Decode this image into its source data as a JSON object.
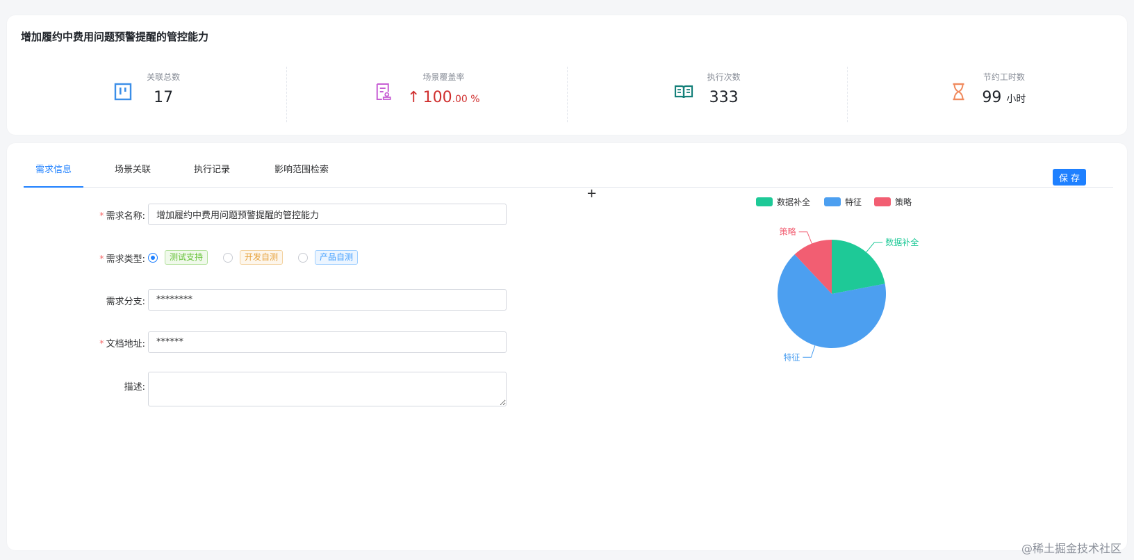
{
  "header": {
    "title": "增加履约中费用问题预警提醒的管控能力"
  },
  "stats": [
    {
      "label": "关联总数",
      "value": "17",
      "unit": "",
      "icon": "kanban-icon",
      "color": "#3b8ee8"
    },
    {
      "label": "场景覆盖率",
      "value": "100",
      "unit": ".00 %",
      "icon": "document-stamp-icon",
      "color": "#c75fd4",
      "trend": "↑"
    },
    {
      "label": "执行次数",
      "value": "333",
      "unit": "",
      "icon": "open-book-icon",
      "color": "#15807a"
    },
    {
      "label": "节约工时数",
      "value": "99",
      "unit": "小时",
      "icon": "hourglass-icon",
      "color": "#f08a5d"
    }
  ],
  "tabs": [
    {
      "label": "需求信息",
      "active": true
    },
    {
      "label": "场景关联",
      "active": false
    },
    {
      "label": "执行记录",
      "active": false
    },
    {
      "label": "影响范围检索",
      "active": false
    }
  ],
  "toolbar": {
    "save_label": "保存"
  },
  "form": {
    "name": {
      "label": "需求名称:",
      "value": "增加履约中费用问题预警提醒的管控能力",
      "required": true
    },
    "type": {
      "label": "需求类型:",
      "required": true,
      "options": [
        {
          "label": "测试支持",
          "checked": true,
          "color": "green"
        },
        {
          "label": "开发自测",
          "checked": false,
          "color": "orange"
        },
        {
          "label": "产品自测",
          "checked": false,
          "color": "blue"
        }
      ]
    },
    "branch": {
      "label": "需求分支:",
      "value": "********",
      "required": false
    },
    "doc": {
      "label": "文档地址:",
      "value": "******",
      "required": true
    },
    "desc": {
      "label": "描述:",
      "value": "",
      "required": false
    }
  },
  "chart_data": {
    "type": "pie",
    "series": [
      {
        "name": "数据补全",
        "value": 22,
        "color": "#1ec997"
      },
      {
        "name": "特征",
        "value": 66,
        "color": "#4c9ff0"
      },
      {
        "name": "策略",
        "value": 12,
        "color": "#f25e72"
      }
    ],
    "legend": "top"
  },
  "watermark": "@稀土掘金技术社区"
}
